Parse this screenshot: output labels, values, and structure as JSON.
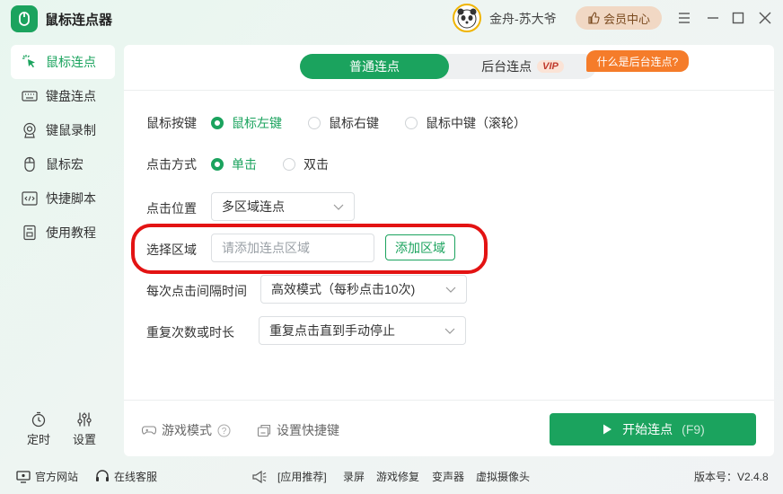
{
  "app": {
    "title": "鼠标连点器"
  },
  "user": {
    "name": "金舟-苏大爷"
  },
  "vip_center": {
    "label": "会员中心"
  },
  "sidebar": {
    "items": [
      {
        "label": "鼠标连点",
        "icon": "cursor-click-icon",
        "active": true
      },
      {
        "label": "键盘连点",
        "icon": "keyboard-icon",
        "active": false
      },
      {
        "label": "键鼠录制",
        "icon": "webcam-icon",
        "active": false
      },
      {
        "label": "鼠标宏",
        "icon": "mouse-icon",
        "active": false
      },
      {
        "label": "快捷脚本",
        "icon": "code-icon",
        "active": false
      },
      {
        "label": "使用教程",
        "icon": "book-icon",
        "active": false
      }
    ],
    "timer_label": "定时",
    "settings_label": "设置"
  },
  "tabs": {
    "normal": "普通连点",
    "background": "后台连点",
    "vip": "VIP",
    "what_bg": "什么是后台连点?"
  },
  "form": {
    "mouse_button": {
      "label": "鼠标按键",
      "options": [
        "鼠标左键",
        "鼠标右键",
        "鼠标中键（滚轮）"
      ],
      "selected": "鼠标左键"
    },
    "click_mode": {
      "label": "点击方式",
      "options": [
        "单击",
        "双击"
      ],
      "selected": "单击"
    },
    "position": {
      "label": "点击位置",
      "value": "多区域连点"
    },
    "area": {
      "label": "选择区域",
      "placeholder": "请添加连点区域",
      "add_button": "添加区域"
    },
    "interval": {
      "label": "每次点击间隔时间",
      "value": "高效模式（每秒点击10次)"
    },
    "repeat": {
      "label": "重复次数或时长",
      "value": "重复点击直到手动停止"
    }
  },
  "footer": {
    "game_mode": "游戏模式",
    "hotkey": "设置快捷键",
    "start": "开始连点",
    "start_hotkey": "(F9)"
  },
  "statusbar": {
    "website": "官方网站",
    "support": "在线客服",
    "recommend": "[应用推荐]",
    "links": [
      "录屏",
      "游戏修复",
      "变声器",
      "虚拟摄像头"
    ],
    "version": "版本号：V2.4.8"
  },
  "colors": {
    "accent": "#1ba35e",
    "highlight": "#e31313",
    "orange": "#f57c2a"
  }
}
